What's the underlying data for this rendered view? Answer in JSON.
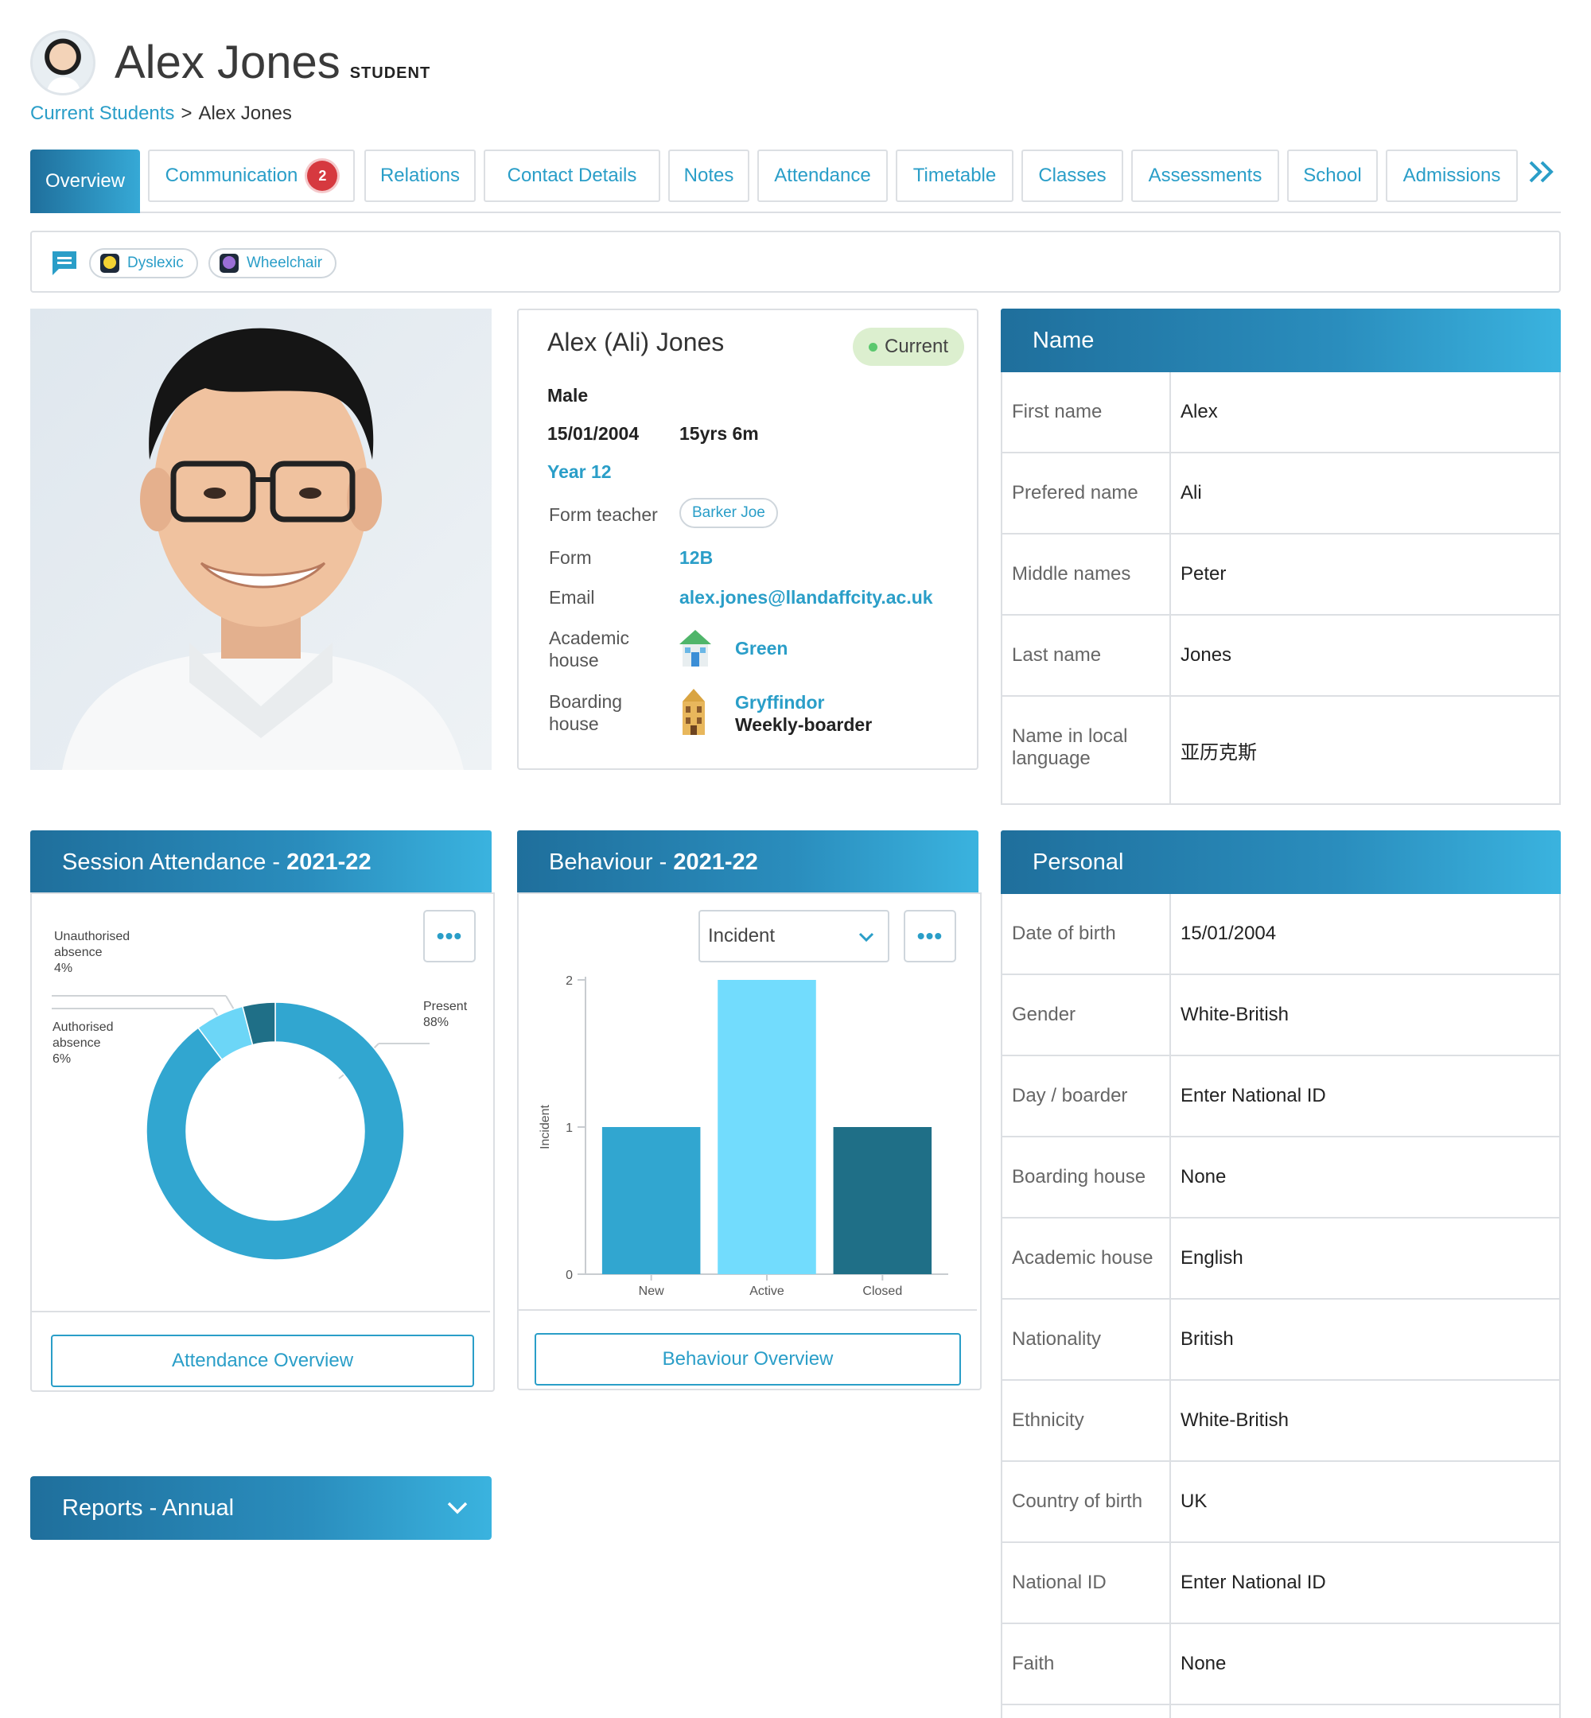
{
  "header": {
    "name": "Alex Jones",
    "role": "STUDENT"
  },
  "breadcrumb": {
    "parent": "Current Students",
    "separator": ">",
    "current": "Alex Jones"
  },
  "tabs": [
    {
      "label": "Overview"
    },
    {
      "label": "Communication",
      "badge": "2"
    },
    {
      "label": "Relations"
    },
    {
      "label": "Contact Details"
    },
    {
      "label": "Notes"
    },
    {
      "label": "Attendance"
    },
    {
      "label": "Timetable"
    },
    {
      "label": "Classes"
    },
    {
      "label": "Assessments"
    },
    {
      "label": "School"
    },
    {
      "label": "Admissions"
    }
  ],
  "tags": [
    {
      "label": "Dyslexic",
      "color": "#f4d233"
    },
    {
      "label": "Wheelchair",
      "color": "#9b6fd6"
    }
  ],
  "profile": {
    "full_name": "Alex (Ali) Jones",
    "status": "Current",
    "gender": "Male",
    "dob": "15/01/2004",
    "age": "15yrs 6m",
    "year": "Year 12",
    "form_teacher_label": "Form teacher",
    "form_teacher": "Barker Joe",
    "form_label": "Form",
    "form": "12B",
    "email_label": "Email",
    "email": "alex.jones@llandaffcity.ac.uk",
    "academic_house_label": "Academic house",
    "academic_house": "Green",
    "boarding_house_label": "Boarding house",
    "boarding_house": "Gryffindor",
    "boarding_type": "Weekly-boarder"
  },
  "name_panel": {
    "title": "Name",
    "rows": [
      {
        "k": "First name",
        "v": "Alex"
      },
      {
        "k": "Prefered name",
        "v": "Ali"
      },
      {
        "k": "Middle names",
        "v": "Peter"
      },
      {
        "k": "Last name",
        "v": "Jones"
      },
      {
        "k": "Name in local language",
        "v": "亚历克斯"
      }
    ]
  },
  "attendance": {
    "title_prefix": "Session Attendance - ",
    "title_year": "2021-22",
    "more": "•••",
    "button": "Attendance Overview",
    "labels": {
      "unauth_1": "Unauthorised",
      "unauth_2": "absence",
      "unauth_pct": "4%",
      "auth_1": "Authorised",
      "auth_2": "absence",
      "auth_pct": "6%",
      "present": "Present",
      "present_pct": "88%"
    }
  },
  "behaviour": {
    "title_prefix": "Behaviour - ",
    "title_year": "2021-22",
    "select": "Incident",
    "more": "•••",
    "button": "Behaviour Overview",
    "ylabel": "Incident"
  },
  "chart_data": [
    {
      "type": "pie",
      "title": "Session Attendance - 2021-22",
      "series": [
        {
          "name": "Present",
          "value": 88,
          "color": "#31a6d0"
        },
        {
          "name": "Authorised absence",
          "value": 6,
          "color": "#6cd6f7"
        },
        {
          "name": "Unauthorised absence",
          "value": 4,
          "color": "#1f6f87"
        }
      ]
    },
    {
      "type": "bar",
      "title": "Behaviour - 2021-22",
      "categories": [
        "New",
        "Active",
        "Closed"
      ],
      "values": [
        1,
        2,
        1
      ],
      "colors": [
        "#31a6d0",
        "#72dcfd",
        "#1f6f87"
      ],
      "ylabel": "Incident",
      "ylim": [
        0,
        2
      ],
      "yticks": [
        "0",
        "1",
        "2"
      ]
    }
  ],
  "reports": {
    "title": "Reports - Annual"
  },
  "personal_panel": {
    "title": "Personal",
    "rows": [
      {
        "k": "Date of birth",
        "v": "15/01/2004"
      },
      {
        "k": "Gender",
        "v": "White-British"
      },
      {
        "k": "Day / boarder",
        "v": "Enter National ID"
      },
      {
        "k": "Boarding house",
        "v": "None"
      },
      {
        "k": "Academic house",
        "v": "English"
      },
      {
        "k": "Nationality",
        "v": "British"
      },
      {
        "k": "Ethnicity",
        "v": "White-British"
      },
      {
        "k": "Country of birth",
        "v": "UK"
      },
      {
        "k": "National ID",
        "v": "Enter National ID"
      },
      {
        "k": "Faith",
        "v": "None"
      }
    ]
  }
}
